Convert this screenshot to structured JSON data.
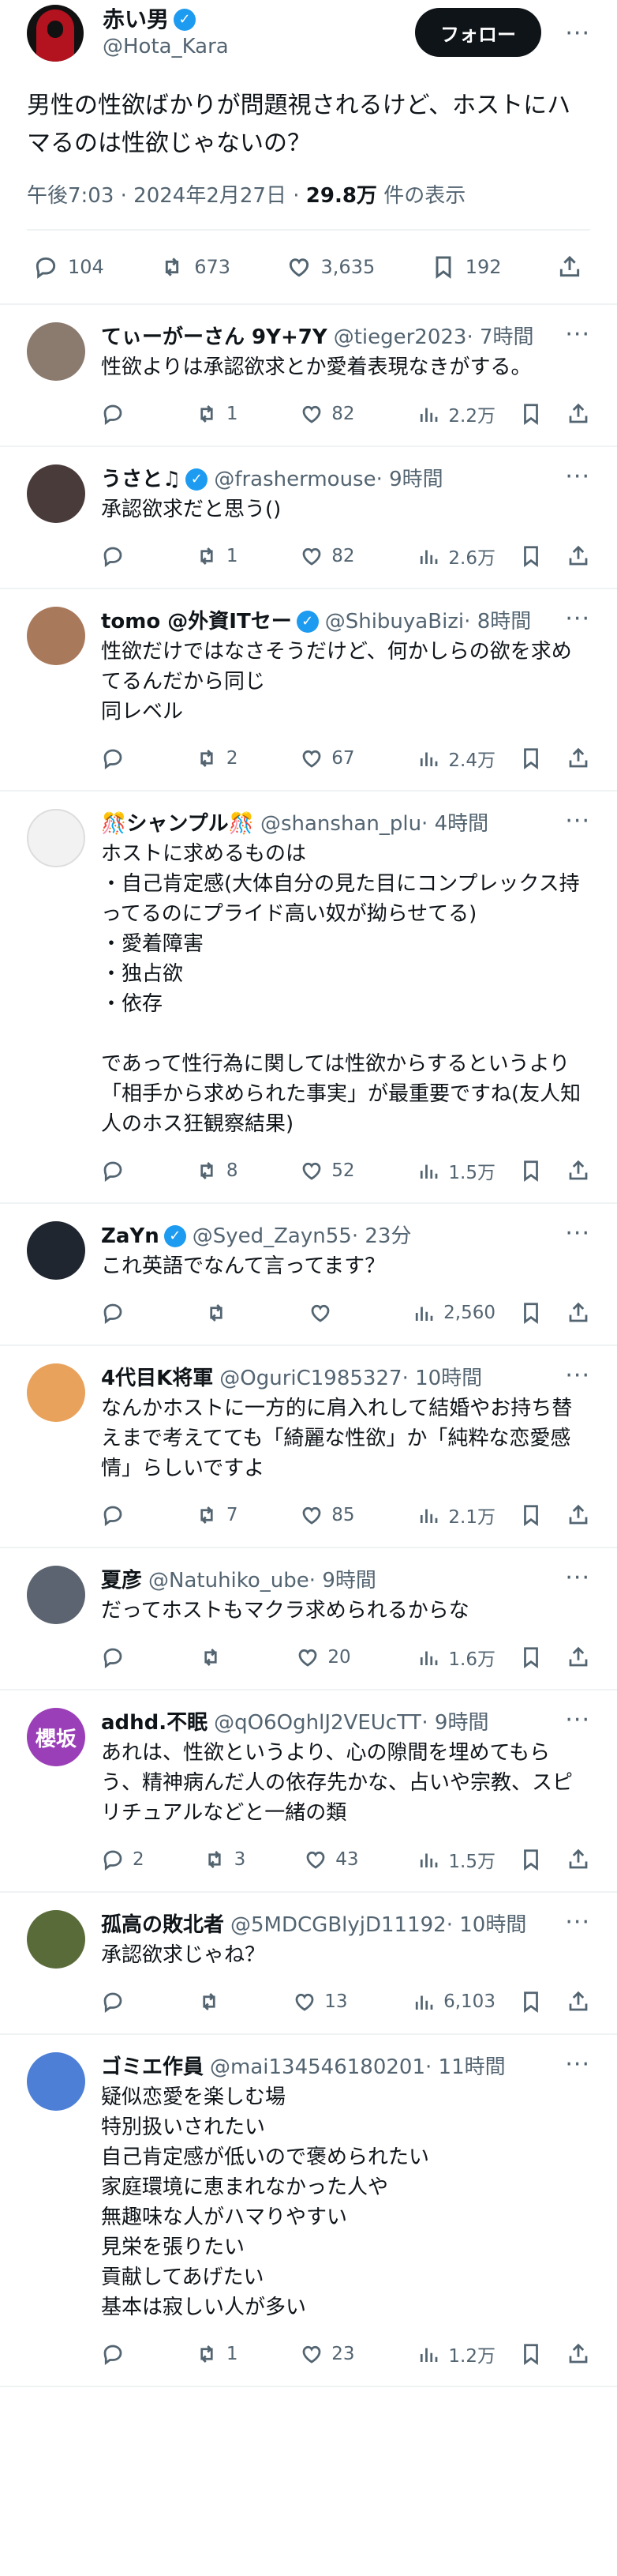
{
  "main": {
    "name": "赤い男",
    "handle": "@Hota_Kara",
    "follow_label": "フォロー",
    "more": "···",
    "text": "男性の性欲ばかりが問題視されるけど、ホストにハマるのは性欲じゃないの？",
    "time": "午後7:03 · 2024年2月27日 · ",
    "views": "29.8万",
    "views_suffix": " 件の表示",
    "stats": {
      "replies": "104",
      "reposts": "673",
      "likes": "3,635",
      "bookmarks": "192"
    }
  },
  "replies": [
    {
      "name": "てぃーがーさん 9Y+7Y",
      "handle": "@tieger2023",
      "time": " · 7時間",
      "text": "性欲よりは承認欲求とか愛着表現なきがする。",
      "reposts": "1",
      "likes": "82",
      "views": "2.2万",
      "verified": false,
      "avatar_color": "#8b7a6e"
    },
    {
      "name": "うさと♫",
      "handle": "@frashermouse",
      "time": " · 9時間",
      "text": "承認欲求だと思う()",
      "reposts": "1",
      "likes": "82",
      "views": "2.6万",
      "verified": true,
      "avatar_color": "#4a3b3b"
    },
    {
      "name": "tomo @外資ITセー",
      "handle": "@ShibuyaBizi",
      "time": " · 8時間",
      "text": "性欲だけではなさそうだけど、何かしらの欲を求めてるんだから同じ\n同レベル",
      "reposts": "2",
      "likes": "67",
      "views": "2.4万",
      "verified": true,
      "avatar_color": "#a9795b"
    },
    {
      "name": "🎊シャンプル🎊",
      "handle": "@shanshan_plu",
      "time": " · 4時間",
      "text": "ホストに求めるものは\n・自己肯定感(大体自分の見た目にコンプレックス持ってるのにプライド高い奴が拗らせてる)\n・愛着障害\n・独占欲\n・依存\n\nであって性行為に関しては性欲からするというより「相手から求められた事実」が最重要ですね(友人知人のホス狂観察結果)",
      "reposts": "8",
      "likes": "52",
      "views": "1.5万",
      "verified": false,
      "avatar_color": "#f2f2f2"
    },
    {
      "name": "ZaYn",
      "handle": "@Syed_Zayn55",
      "time": " · 23分",
      "text": "これ英語でなんて言ってます？",
      "reposts": "",
      "likes": "",
      "views": "2,560",
      "verified": true,
      "avatar_color": "#1f2630"
    },
    {
      "name": "4代目K将軍",
      "handle": "@OguriC1985327",
      "time": " · 10時間",
      "text": "なんかホストに一方的に肩入れして結婚やお持ち替えまで考えてても「綺麗な性欲」か「純粋な恋愛感情」らしいですよ",
      "reposts": "7",
      "likes": "85",
      "views": "2.1万",
      "verified": false,
      "avatar_color": "#e9a25c"
    },
    {
      "name": "夏彦",
      "handle": "@Natuhiko_ube",
      "time": " · 9時間",
      "text": "だってホストもマクラ求められるからな",
      "reposts": "",
      "likes": "20",
      "views": "1.6万",
      "verified": false,
      "avatar_color": "#5b6470"
    },
    {
      "name": "adhd.不眠",
      "handle": "@qO6OghlJ2VEUcTT",
      "time": " · 9時間",
      "text": "あれは、性欲というより、心の隙間を埋めてもらう、精神病んだ人の依存先かな、占いや宗教、スピリチュアルなどと一緒の類",
      "reposts": "3",
      "likes": "43",
      "views": "1.5万",
      "verified": false,
      "avatar_color": "#9b3fb8",
      "avatar_text": "櫻坂",
      "replies": "2"
    },
    {
      "name": "孤高の敗北者",
      "handle": "@5MDCGBlyjD11192",
      "time": " · 10時間",
      "text": "承認欲求じゃね？",
      "reposts": "",
      "likes": "13",
      "views": "6,103",
      "verified": false,
      "avatar_color": "#5a6b3a"
    },
    {
      "name": "ゴミエ作員",
      "handle": "@mai134546180201",
      "time": " · 11時間",
      "text": "疑似恋愛を楽しむ場\n特別扱いされたい\n自己肯定感が低いので褒められたい\n家庭環境に恵まれなかった人や\n無趣味な人がハマりやすい\n見栄を張りたい\n貢献してあげたい\n基本は寂しい人が多い",
      "reposts": "1",
      "likes": "23",
      "views": "1.2万",
      "verified": false,
      "avatar_color": "#4d7fd6"
    }
  ],
  "icon_names": [
    "reply-icon",
    "repost-icon",
    "like-icon",
    "views-icon",
    "bookmark-icon",
    "share-icon",
    "verified-badge-icon",
    "more-icon"
  ]
}
